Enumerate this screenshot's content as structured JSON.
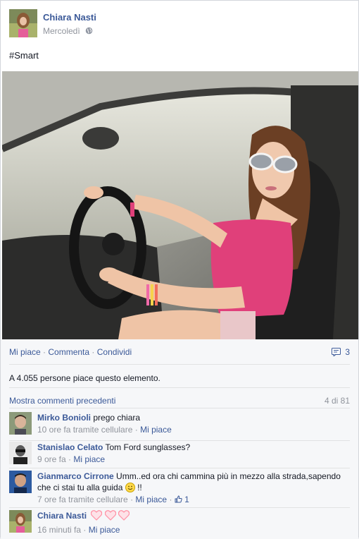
{
  "post": {
    "author": "Chiara Nasti",
    "day": "Mercoledì",
    "text": "#Smart"
  },
  "actions": {
    "like": "Mi piace",
    "comment": "Commenta",
    "share": "Condividi",
    "comment_count": "3"
  },
  "likes_summary": "A 4.055 persone piace questo elemento.",
  "comments_header": {
    "show_previous": "Mostra commenti precedenti",
    "pager": "4 di 81"
  },
  "comments": [
    {
      "name": "Mirko Bonioli",
      "text": "prego chiara",
      "time": "10 ore fa tramite cellulare",
      "like": "Mi piace"
    },
    {
      "name": "Stanislao Celato",
      "text": "Tom Ford sunglasses?",
      "time": "9 ore fa",
      "like": "Mi piace"
    },
    {
      "name": "Gianmarco Cirrone",
      "text": "Umm..ed ora chi cammina più in mezzo alla strada,sapendo che ci stai tu alla guida",
      "text_suffix": "!!",
      "time": "7 ore fa tramite cellulare",
      "like": "Mi piace",
      "like_count": "1"
    },
    {
      "name": "Chiara Nasti",
      "text": "",
      "time": "16 minuti fa",
      "like": "Mi piace"
    }
  ],
  "colors": {
    "link": "#3b5998",
    "muted": "#90949c",
    "heart": "#ff8fa3"
  }
}
